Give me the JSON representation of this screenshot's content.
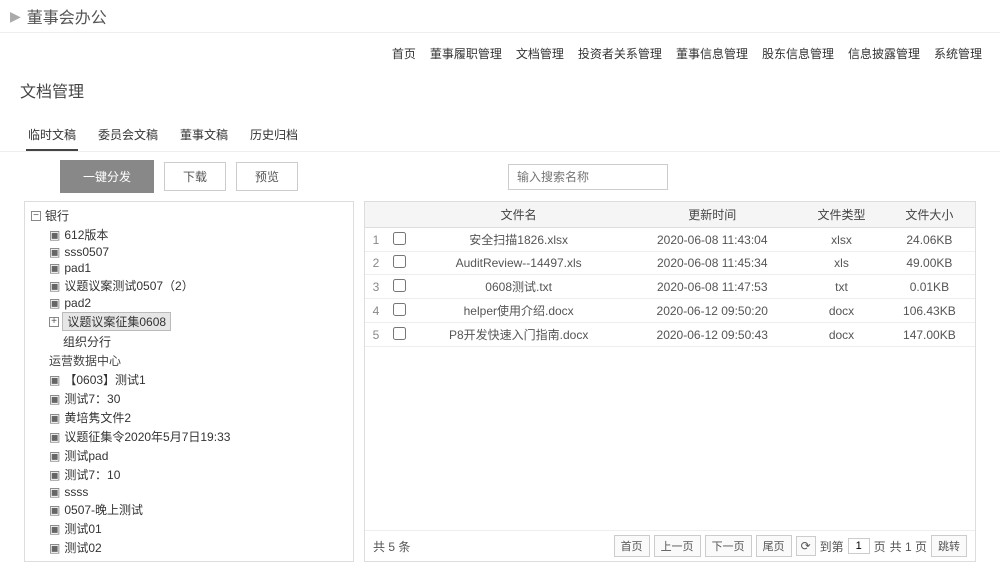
{
  "header": {
    "title": "董事会办公"
  },
  "topnav": [
    "首页",
    "董事履职管理",
    "文档管理",
    "投资者关系管理",
    "董事信息管理",
    "股东信息管理",
    "信息披露管理",
    "系统管理"
  ],
  "section": {
    "title": "文档管理"
  },
  "tabs": [
    {
      "label": "临时文稿",
      "active": true
    },
    {
      "label": "委员会文稿",
      "active": false
    },
    {
      "label": "董事文稿",
      "active": false
    },
    {
      "label": "历史归档",
      "active": false
    }
  ],
  "toolbar": {
    "distribute": "一键分发",
    "download": "下载",
    "preview": "预览"
  },
  "search": {
    "placeholder": "输入搜索名称"
  },
  "tree": {
    "root": "银行",
    "group1": [
      {
        "label": "612版本"
      },
      {
        "label": "sss0507"
      },
      {
        "label": "pad1"
      },
      {
        "label": "议题议案测试0507（2）"
      },
      {
        "label": "pad2"
      },
      {
        "label": "议题议案征集0608",
        "selected": true
      },
      {
        "label": "组织分行",
        "grouping": true
      }
    ],
    "sectionA": "运营数据中心",
    "group2": [
      {
        "label": "【0603】测试1"
      },
      {
        "label": "测试7：30"
      },
      {
        "label": "黄培隽文件2"
      },
      {
        "label": "议题征集令2020年5月7日19:33"
      },
      {
        "label": "测试pad"
      },
      {
        "label": "测试7：10"
      },
      {
        "label": "ssss"
      },
      {
        "label": "0507-晚上测试"
      },
      {
        "label": "测试01"
      },
      {
        "label": "测试02"
      }
    ]
  },
  "table": {
    "headers": {
      "name": "文件名",
      "time": "更新时间",
      "type": "文件类型",
      "size": "文件大小"
    },
    "rows": [
      {
        "idx": "1",
        "name": "安全扫描1826.xlsx",
        "time": "2020-06-08 11:43:04",
        "type": "xlsx",
        "size": "24.06KB"
      },
      {
        "idx": "2",
        "name": "AuditReview--14497.xls",
        "time": "2020-06-08 11:45:34",
        "type": "xls",
        "size": "49.00KB"
      },
      {
        "idx": "3",
        "name": "0608测试.txt",
        "time": "2020-06-08 11:47:53",
        "type": "txt",
        "size": "0.01KB"
      },
      {
        "idx": "4",
        "name": "helper使用介绍.docx",
        "time": "2020-06-12 09:50:20",
        "type": "docx",
        "size": "106.43KB"
      },
      {
        "idx": "5",
        "name": "P8开发快速入门指南.docx",
        "time": "2020-06-12 09:50:43",
        "type": "docx",
        "size": "147.00KB"
      }
    ]
  },
  "pager": {
    "total_label": "共 5 条",
    "first": "首页",
    "prev": "上一页",
    "next": "下一页",
    "last": "尾页",
    "jump_prefix": "到第",
    "page_value": "1",
    "page_suffix": "页",
    "total_pages": "共 1 页",
    "go": "跳转"
  }
}
